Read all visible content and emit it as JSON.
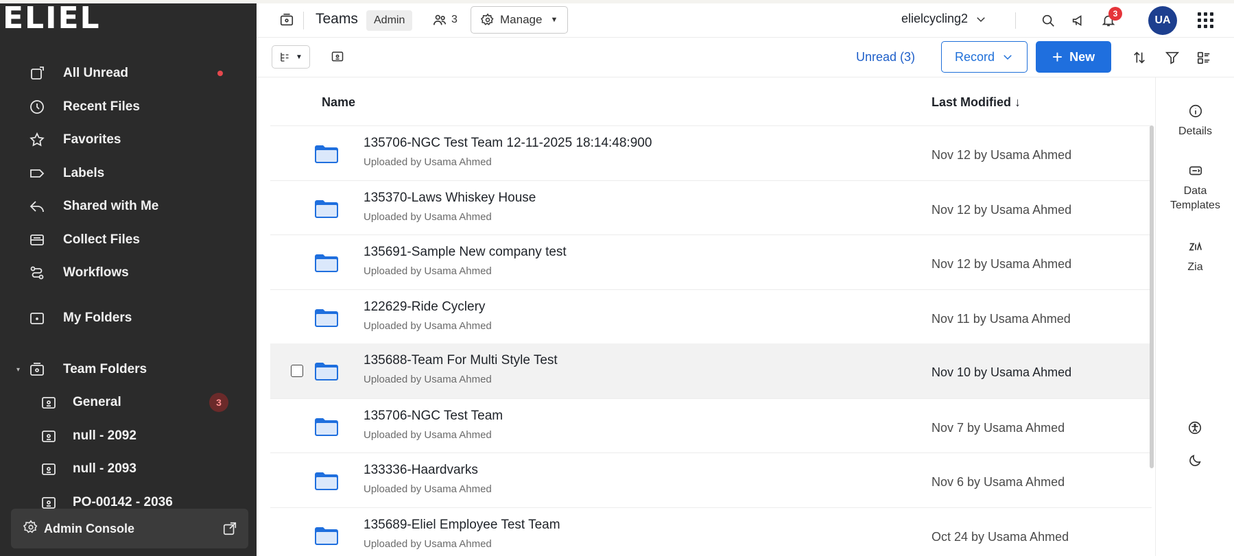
{
  "app": {
    "logo_text": "ELIEL"
  },
  "sidebar": {
    "items": [
      {
        "label": "All Unread",
        "icon": "unread-icon",
        "has_dot": true
      },
      {
        "label": "Recent Files",
        "icon": "clock-icon"
      },
      {
        "label": "Favorites",
        "icon": "star-icon"
      },
      {
        "label": "Labels",
        "icon": "label-icon"
      },
      {
        "label": "Shared with Me",
        "icon": "share-icon"
      },
      {
        "label": "Collect Files",
        "icon": "inbox-icon"
      },
      {
        "label": "Workflows",
        "icon": "workflow-icon"
      }
    ],
    "my_folders": "My Folders",
    "team_folders": {
      "label": "Team Folders",
      "items": [
        {
          "label": "General",
          "badge": "3"
        },
        {
          "label": "null - 2092"
        },
        {
          "label": "null - 2093"
        },
        {
          "label": "PO-00142 - 2036"
        }
      ]
    },
    "admin_console": "Admin Console"
  },
  "topbar": {
    "title": "Teams",
    "role_badge": "Admin",
    "member_count": "3",
    "manage_label": "Manage",
    "workspace": "elielcycling2",
    "notification_count": "3",
    "avatar_initials": "UA"
  },
  "toolbar": {
    "unread_label": "Unread (3)",
    "record_label": "Record",
    "new_label": "New"
  },
  "list": {
    "col_name": "Name",
    "col_modified": "Last Modified ↓",
    "rows": [
      {
        "title": "135706-NGC Test Team 12-11-2025 18:14:48:900",
        "sub": "Uploaded by Usama Ahmed",
        "modified": "Nov 12 by Usama Ahmed"
      },
      {
        "title": "135370-Laws Whiskey House",
        "sub": "Uploaded by Usama Ahmed",
        "modified": "Nov 12 by Usama Ahmed"
      },
      {
        "title": "135691-Sample New company test",
        "sub": "Uploaded by Usama Ahmed",
        "modified": "Nov 12 by Usama Ahmed"
      },
      {
        "title": "122629-Ride Cyclery",
        "sub": "Uploaded by Usama Ahmed",
        "modified": "Nov 11 by Usama Ahmed"
      },
      {
        "title": "135688-Team For Multi Style Test",
        "sub": "Uploaded by Usama Ahmed",
        "modified": "Nov 10 by Usama Ahmed",
        "hover": true
      },
      {
        "title": "135706-NGC Test Team",
        "sub": "Uploaded by Usama Ahmed",
        "modified": "Nov 7 by Usama Ahmed"
      },
      {
        "title": "133336-Haardvarks",
        "sub": "Uploaded by Usama Ahmed",
        "modified": "Nov 6 by Usama Ahmed"
      },
      {
        "title": "135689-Eliel Employee Test Team",
        "sub": "Uploaded by Usama Ahmed",
        "modified": "Oct 24 by Usama Ahmed"
      }
    ]
  },
  "rail": {
    "details": "Details",
    "data_templates_1": "Data",
    "data_templates_2": "Templates",
    "zia": "Zia"
  },
  "colors": {
    "sidebar_bg": "#2b2b2b",
    "accent_blue": "#1f6fde",
    "folder_blue": "#1f6fde",
    "notif_red": "#e5343a",
    "avatar_bg": "#1d3f8f"
  }
}
